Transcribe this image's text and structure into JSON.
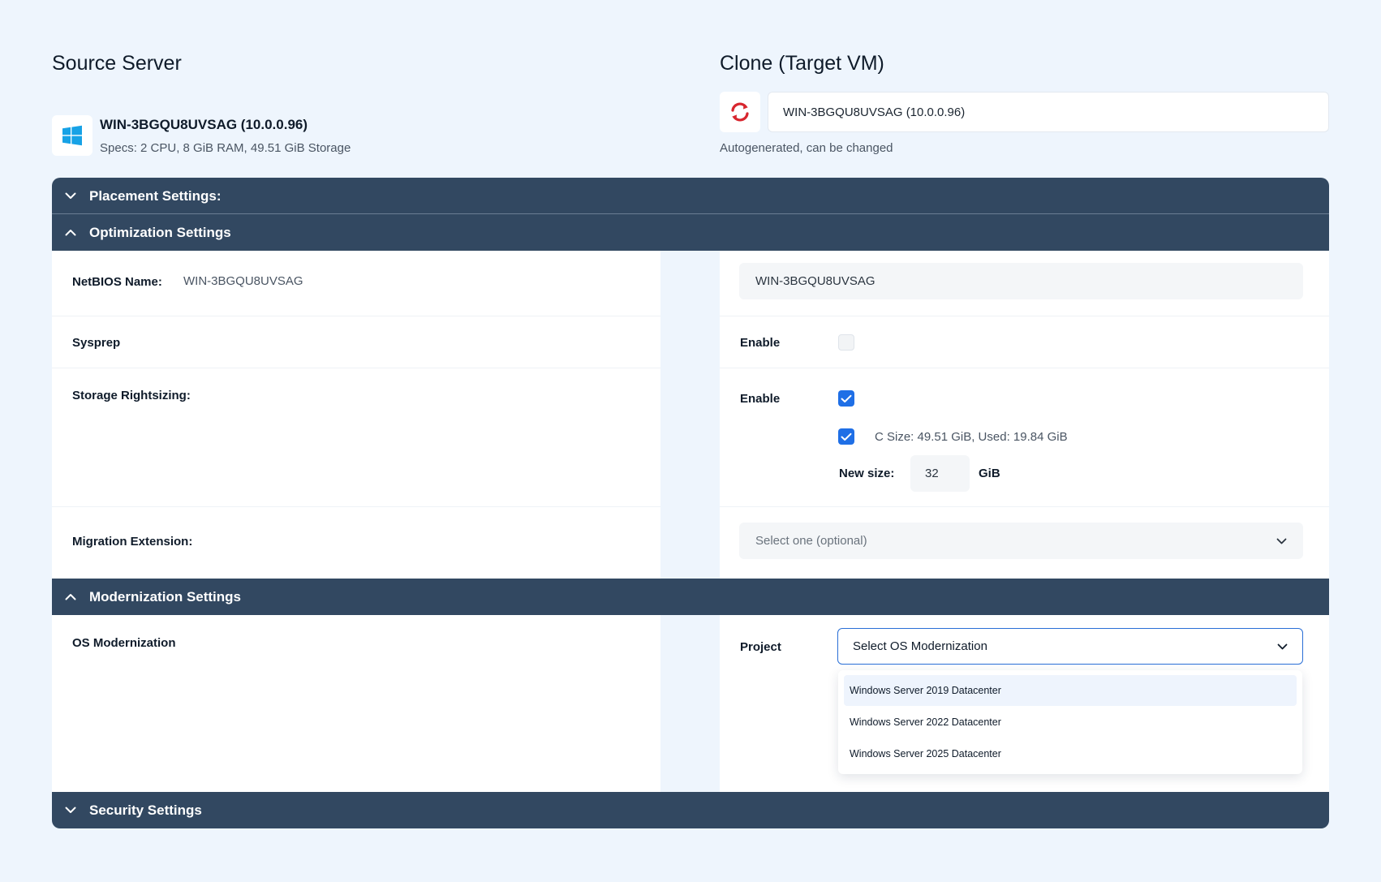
{
  "source": {
    "title": "Source Server",
    "os_icon": "windows-logo-icon",
    "server_name": "WIN-3BGQU8UVSAG (10.0.0.96)",
    "specs": "Specs: 2 CPU, 8 GiB RAM, 49.51 GiB Storage"
  },
  "clone": {
    "title": "Clone (Target VM)",
    "icon": "sync-icon",
    "name_value": "WIN-3BGQU8UVSAG (10.0.0.96)",
    "hint": "Autogenerated, can be changed"
  },
  "sections": {
    "placement": {
      "label": "Placement Settings:",
      "expanded": false
    },
    "optimization": {
      "label": "Optimization Settings",
      "expanded": true
    },
    "modernization": {
      "label": "Modernization Settings",
      "expanded": true
    },
    "security": {
      "label": "Security Settings",
      "expanded": false
    }
  },
  "optimization": {
    "netbios": {
      "label": "NetBIOS Name:",
      "source_value": "WIN-3BGQU8UVSAG",
      "target_value": "WIN-3BGQU8UVSAG"
    },
    "sysprep": {
      "label": "Sysprep",
      "enable_label": "Enable",
      "enabled": false
    },
    "storage": {
      "label": "Storage Rightsizing:",
      "enable_label": "Enable",
      "enabled": true,
      "disk_label": "C Size: 49.51 GiB, Used: 19.84 GiB",
      "disk_checked": true,
      "new_size_label": "New size:",
      "new_size_value": "32",
      "unit": "GiB"
    },
    "migration_extension": {
      "label": "Migration Extension:",
      "placeholder": "Select one (optional)"
    }
  },
  "modernization": {
    "os_label": "OS Modernization",
    "project_label": "Project",
    "select_placeholder": "Select OS Modernization",
    "options": [
      "Windows Server 2019 Datacenter",
      "Windows Server 2022 Datacenter",
      "Windows Server 2025 Datacenter"
    ]
  },
  "colors": {
    "background": "#eef5fd",
    "section_bar": "#324861",
    "accent": "#1f6fe6",
    "sync_icon": "#d8262f",
    "windows_logo": "#17a2e6"
  }
}
